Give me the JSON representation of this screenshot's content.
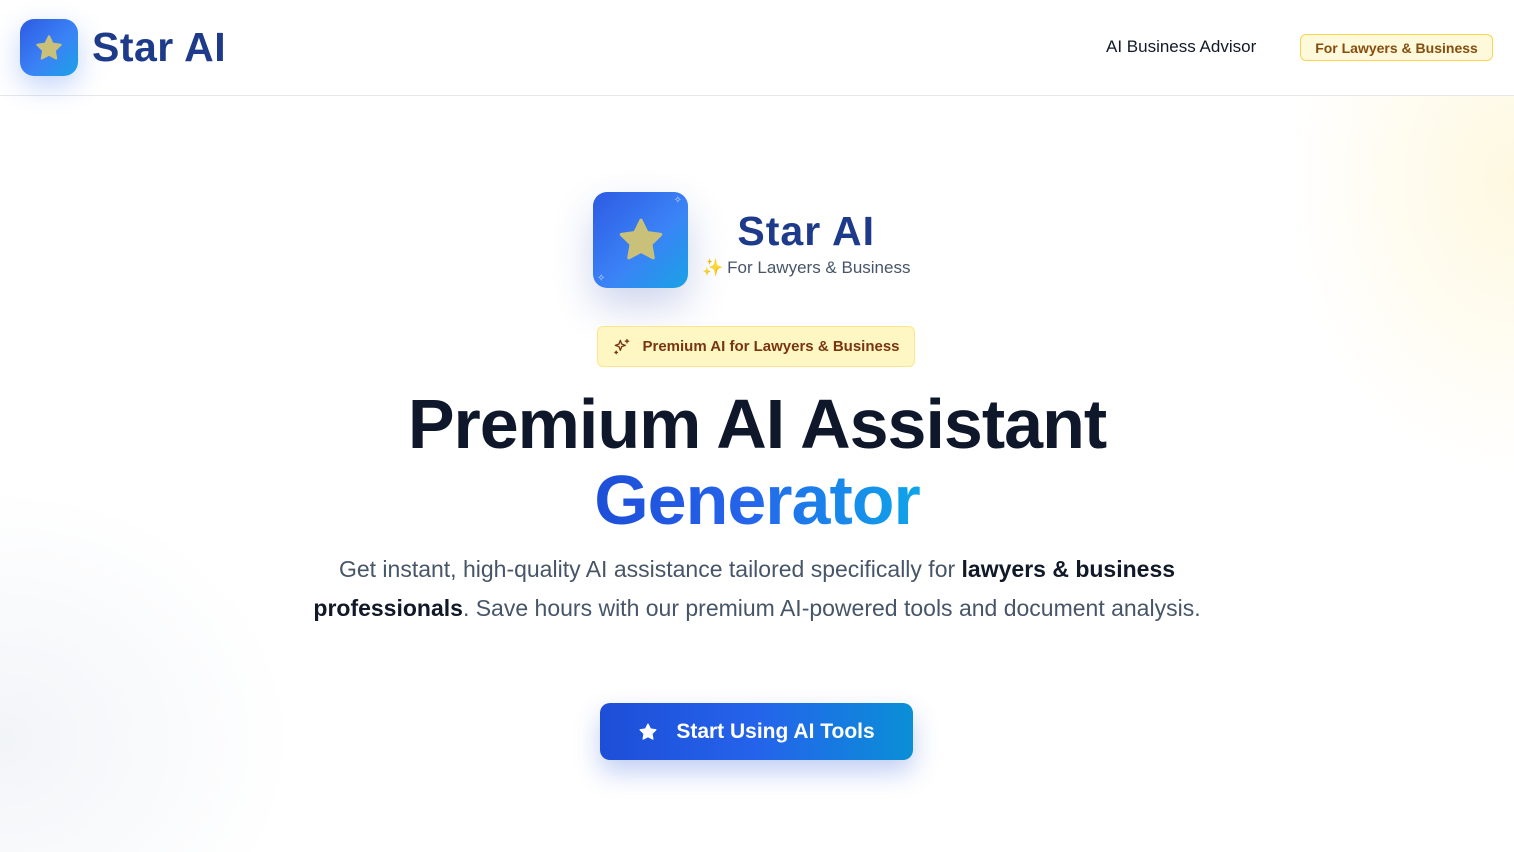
{
  "header": {
    "brand_name": "Star AI",
    "brand_icon": "star-icon",
    "nav_link": "AI Business Advisor",
    "nav_pill": "For Lawyers & Business"
  },
  "hero": {
    "logo_name": "Star AI",
    "logo_subtitle_icon": "✨",
    "logo_subtitle": "For Lawyers & Business",
    "badge_icon": "sparkles-icon",
    "badge_text": "Premium AI for Lawyers & Business",
    "headline_line1": "Premium AI Assistant",
    "headline_line2": "Generator",
    "description": {
      "part1": "Get instant, high-quality AI assistance tailored specifically for ",
      "bold1": "lawyers & business professionals",
      "part2": ". Save hours with our premium AI-powered tools and document analysis."
    },
    "cta_icon": "star-icon",
    "cta_label": "Start Using AI Tools"
  },
  "colors": {
    "brand_blue": "#1e3a8a",
    "accent_gradient_start": "#1d4ed8",
    "accent_gradient_end": "#0ea5e9",
    "star_fill": "#c9c07a",
    "badge_bg": "#fef7c3",
    "badge_text": "#78350f"
  }
}
